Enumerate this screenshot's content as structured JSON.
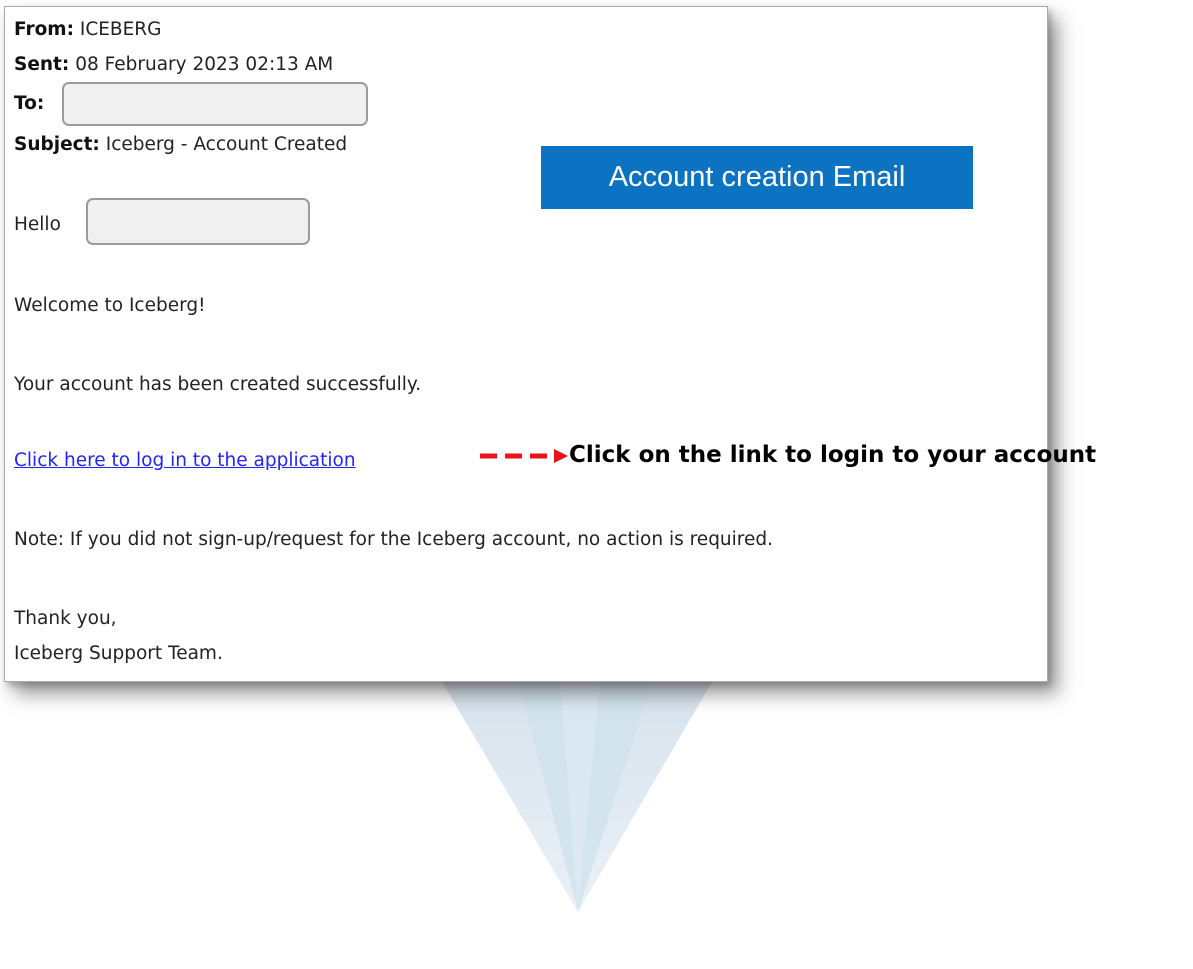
{
  "email": {
    "from_label": "From:",
    "from_value": "ICEBERG",
    "sent_label": "Sent:",
    "sent_value": "08 February 2023 02:13 AM",
    "to_label": "To:",
    "subject_label": "Subject:",
    "subject_value": "Iceberg - Account Created",
    "greeting": "Hello",
    "welcome": "Welcome to Iceberg!",
    "body_created": "Your account has been created successfully.",
    "login_link": "Click here to log in to the application",
    "note": "Note: If you did not sign-up/request for the Iceberg account, no action is required.",
    "closing": "Thank you,",
    "signature": "Iceberg Support Team."
  },
  "annotations": {
    "badge_label": "Account creation Email",
    "callout": "Click on the link to login to your account",
    "arrow_color": "#e8141a"
  },
  "colors": {
    "badge_background": "#0b73c2",
    "link": "#2323ff"
  }
}
